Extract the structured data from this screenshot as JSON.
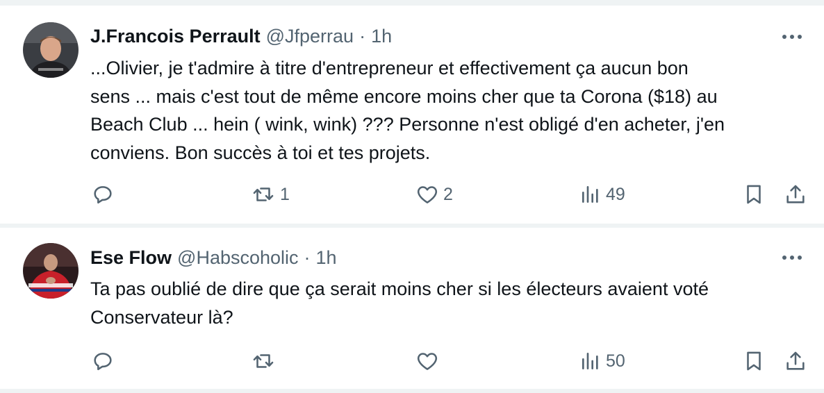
{
  "tweets": [
    {
      "name": "J.Francois Perrault",
      "handle": "@Jfperrau",
      "separator": "·",
      "time": "1h",
      "text_lines": [
        "...Olivier, je t'admire à titre d'entrepreneur et effectivement ça aucun bon",
        "sens ... mais c'est tout de même encore moins cher que ta Corona ($18) au",
        "Beach Club ... hein ( wink, wink)  ???  Personne n'est obligé d'en acheter, j'en",
        "conviens.  Bon succès à toi et tes projets."
      ],
      "reply_count": "",
      "retweet_count": "1",
      "like_count": "2",
      "view_count": "49"
    },
    {
      "name": "Ese Flow",
      "handle": "@Habscoholic",
      "separator": "·",
      "time": "1h",
      "text_lines": [
        "Ta pas oublié de dire que ça serait moins cher si les électeurs avaient voté",
        "Conservateur là?"
      ],
      "reply_count": "",
      "retweet_count": "",
      "like_count": "",
      "view_count": "50"
    }
  ],
  "icons": {
    "reply": "reply-icon",
    "retweet": "retweet-icon",
    "like": "heart-icon",
    "views": "views-icon",
    "bookmark": "bookmark-icon",
    "share": "share-icon",
    "more": "more-icon"
  },
  "colors": {
    "text": "#0f1419",
    "secondary": "#536471",
    "divider": "#eff3f4"
  }
}
